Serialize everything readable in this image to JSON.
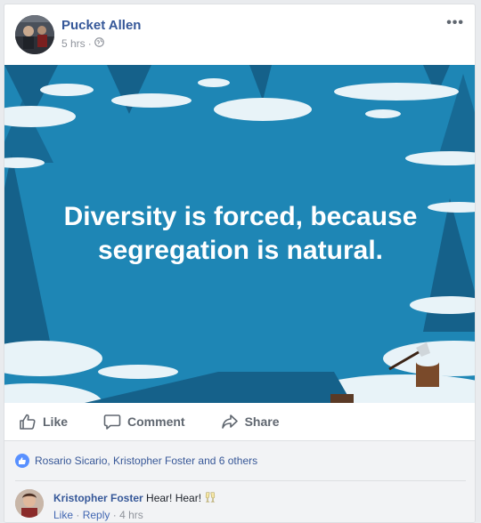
{
  "post": {
    "author": "Pucket Allen",
    "time": "5 hrs",
    "time_separator": "·",
    "more_label": "•••",
    "quote_line1": "Diversity is forced, because",
    "quote_line2": "segregation is natural."
  },
  "actions": {
    "like": "Like",
    "comment": "Comment",
    "share": "Share"
  },
  "reactions": {
    "summary": "Rosario Sicario, Kristopher Foster and 6 others"
  },
  "comment": {
    "author": "Kristopher Foster",
    "text": "Hear! Hear!",
    "like": "Like",
    "reply": "Reply",
    "separator": "·",
    "time": "4 hrs"
  },
  "colors": {
    "link": "#365899",
    "image_bg": "#1e86b5",
    "like_badge": "#5890ff"
  },
  "icons": {
    "privacy": "globe-icon",
    "like": "thumbs-up-icon",
    "comment": "speech-bubble-icon",
    "share": "share-arrow-icon",
    "emoji": "clinking-glasses-icon"
  }
}
